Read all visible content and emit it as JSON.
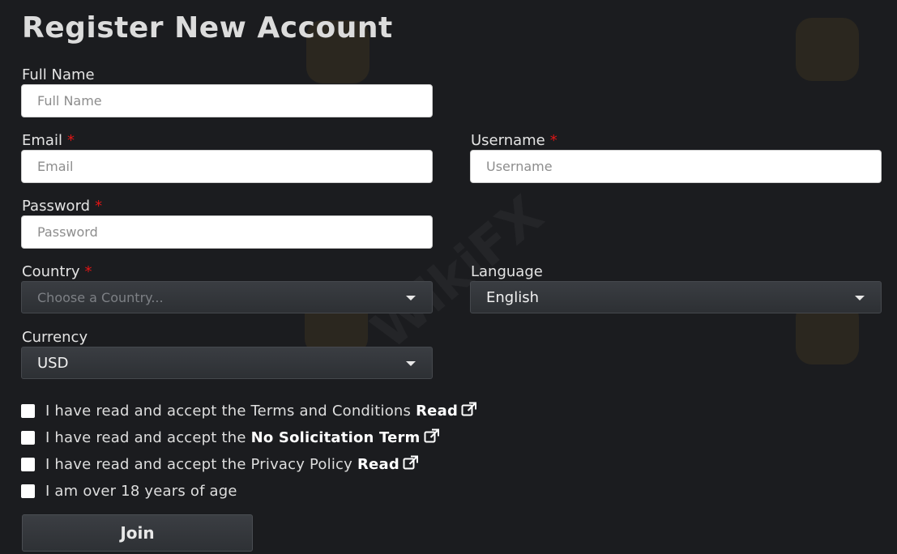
{
  "form": {
    "title": "Register New Account",
    "full_name": {
      "label": "Full Name",
      "placeholder": "Full Name"
    },
    "email": {
      "label": "Email",
      "required_mark": "*",
      "placeholder": "Email"
    },
    "username": {
      "label": "Username",
      "required_mark": "*",
      "placeholder": "Username"
    },
    "password": {
      "label": "Password",
      "required_mark": "*",
      "placeholder": "Password"
    },
    "country": {
      "label": "Country",
      "required_mark": "*",
      "placeholder": "Choose a Country..."
    },
    "language": {
      "label": "Language",
      "selected": "English"
    },
    "currency": {
      "label": "Currency",
      "selected": "USD"
    },
    "checkboxes": [
      {
        "text": "I have read and accept the Terms and Conditions",
        "link": "Read",
        "checked": false
      },
      {
        "text": "I have read and accept the",
        "link": "No Solicitation Term",
        "checked": false
      },
      {
        "text": "I have read and accept the Privacy Policy",
        "link": "Read",
        "checked": false
      },
      {
        "text": "I am over 18 years of age",
        "link": "",
        "checked": false
      }
    ],
    "submit_label": "Join"
  },
  "watermark": {
    "text": "WikiFX",
    "color": "#c08c28"
  },
  "colors": {
    "background": "#1b1c1f",
    "required": "#e01515"
  }
}
